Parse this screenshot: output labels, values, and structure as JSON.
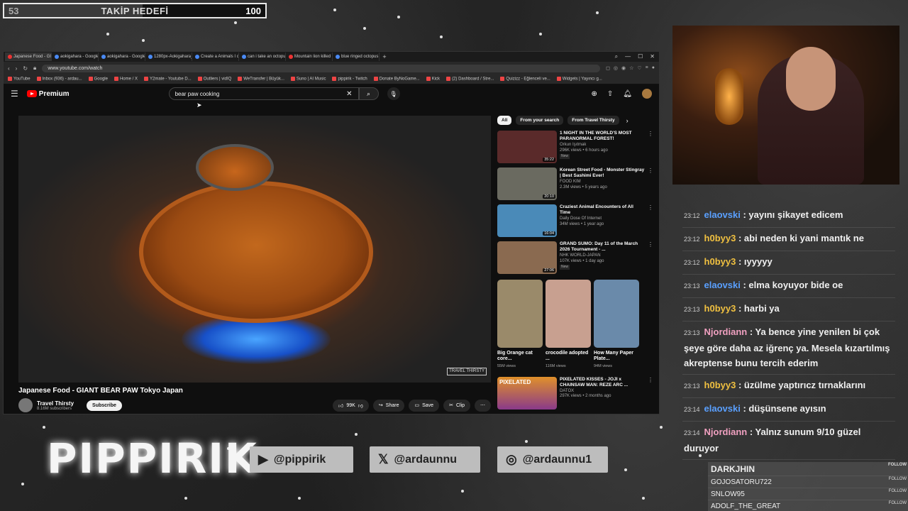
{
  "goal": {
    "current": "53",
    "title": "TAKİP HEDEFİ",
    "max": "100",
    "progress": 0.53
  },
  "browser": {
    "tabs": [
      {
        "label": "Japanese Food - GIANT B",
        "active": true
      },
      {
        "label": "aokigahara - Google'da A"
      },
      {
        "label": "aokigahara - Google'da A"
      },
      {
        "label": "1280px-Aokigahara_forest"
      },
      {
        "label": "Create a Animals I could b"
      },
      {
        "label": "can i take an octopus in a"
      },
      {
        "label": "Mountain lion killed by C"
      },
      {
        "label": "blue ringed octopus how"
      }
    ],
    "url": "www.youtube.com/watch",
    "bookmarks": [
      "YouTube",
      "Inbox (936) - ardau...",
      "Google",
      "Home / X",
      "Y2mate - Youtube D...",
      "Outliers | vidIQ",
      "WeTransfer | Büyük...",
      "Suno | AI Music",
      "pippirik - Twitch",
      "Donate ByNoGame...",
      "Kick",
      "(2) Dashboard / Stre...",
      "Quizizz - Eğlenceli ve...",
      "Widgets | Yayıncı g..."
    ]
  },
  "youtube": {
    "logo": "Premium",
    "search_value": "bear paw cooking",
    "video_watermark": "TRAVEL THIRSTY",
    "video_title": "Japanese Food - GIANT BEAR PAW Tokyo Japan",
    "channel": {
      "name": "Travel Thirsty",
      "subs": "8.16M subscribers",
      "subscribe_label": "Subscribe"
    },
    "actions": {
      "likes": "99K",
      "share": "Share",
      "save": "Save",
      "clip": "Clip"
    },
    "chips": [
      "All",
      "From your search",
      "From Travel Thirsty"
    ],
    "recommended": [
      {
        "title": "1 NIGHT IN THE WORLD'S MOST PARANORMAL FOREST!",
        "channel": "Orkun Işıtmak",
        "meta": "296K views • 6 hours ago",
        "duration": "35:22",
        "badge": "New",
        "color": "#5a2a2a"
      },
      {
        "title": "Korean Street Food - Monster Stingray | Best Sashimi Ever!",
        "channel": "FOOD KIM",
        "meta": "2.3M views • 5 years ago",
        "duration": "20:10",
        "badge": "",
        "color": "#6a6a60"
      },
      {
        "title": "Craziest Animal Encounters of All Time",
        "channel": "Daily Dose Of Internet",
        "meta": "34M views • 1 year ago",
        "duration": "16:04",
        "badge": "",
        "color": "#4a8ab8"
      },
      {
        "title": "GRAND SUMO: Day 11 of the March 2026 Tournament - ...",
        "channel": "NHK WORLD-JAPAN",
        "meta": "107K views • 1 day ago",
        "duration": "27:06",
        "badge": "New",
        "color": "#8a6a50"
      }
    ],
    "shorts": [
      {
        "title": "Big Orange cat core...",
        "views": "55M views",
        "color": "#9a8a6a"
      },
      {
        "title": "crocodile adopted ...",
        "views": "116M views",
        "color": "#c8a090"
      },
      {
        "title": "How Many Paper Plate...",
        "views": "94M views",
        "color": "#6a8aaa"
      }
    ],
    "last_rec": {
      "title": "PIXELATED KISSES - JOJI x CHAINSAW MAN: REZE ARC ...",
      "channel": "DATOX",
      "meta": "297K views • 2 months ago",
      "thumb_text": "PIXELATED"
    }
  },
  "chat": [
    {
      "time": "23:12",
      "user": "elaovski",
      "color": "#5aa0ff",
      "msg": "yayını şikayet edicem"
    },
    {
      "time": "23:12",
      "user": "h0byy3",
      "color": "#f0c040",
      "msg": "abi neden ki yani mantık ne"
    },
    {
      "time": "23:12",
      "user": "h0byy3",
      "color": "#f0c040",
      "msg": "ıyyyyy"
    },
    {
      "time": "23:13",
      "user": "elaovski",
      "color": "#5aa0ff",
      "msg": "elma koyuyor bide oe"
    },
    {
      "time": "23:13",
      "user": "h0byy3",
      "color": "#f0c040",
      "msg": "harbi ya"
    },
    {
      "time": "23:13",
      "user": "Njordiann",
      "color": "#f0a0c0",
      "msg": "Ya bence yine yenilen bi çok şeye göre daha az iğrenç ya. Mesela kızartılmış akreptense bunu tercih ederim"
    },
    {
      "time": "23:13",
      "user": "h0byy3",
      "color": "#f0c040",
      "msg": "üzülme yaptırıcz tırnaklarını"
    },
    {
      "time": "23:14",
      "user": "elaovski",
      "color": "#5aa0ff",
      "msg": "düşünsene ayısın"
    },
    {
      "time": "23:14",
      "user": "Njordiann",
      "color": "#f0a0c0",
      "msg": "Yalnız sunum 9/10 güzel duruyor"
    }
  ],
  "brand": "PIPPIRIK",
  "socials": [
    {
      "icon": "youtube-icon",
      "handle": "@pippirik"
    },
    {
      "icon": "x-icon",
      "handle": "@ardaunnu"
    },
    {
      "icon": "instagram-icon",
      "handle": "@ardaunnu1"
    }
  ],
  "follows": [
    {
      "name": "DARKJHIN",
      "tag": "FOLLOW"
    },
    {
      "name": "GOJOSATORU722",
      "tag": "FOLLOW"
    },
    {
      "name": "SNLOW95",
      "tag": "FOLLOW"
    },
    {
      "name": "ADOLF_THE_GREAT",
      "tag": "FOLLOW"
    }
  ]
}
